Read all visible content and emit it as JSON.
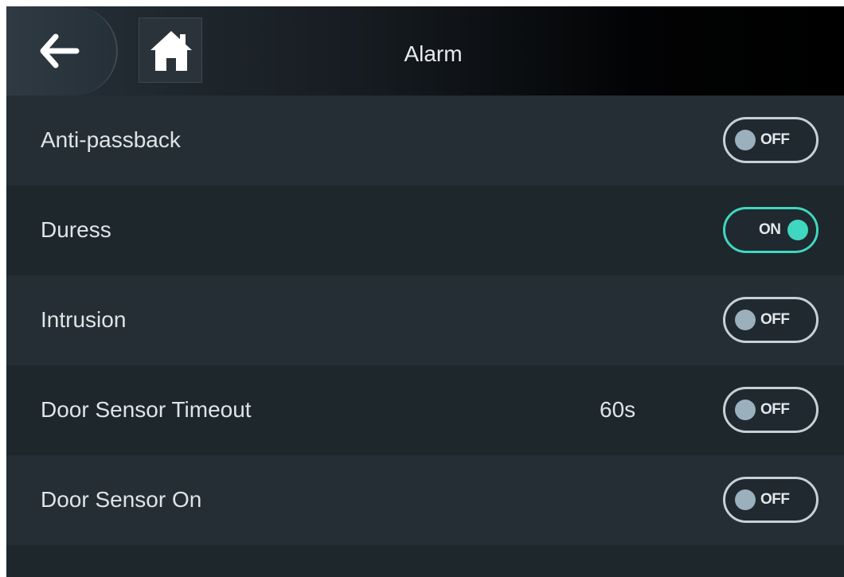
{
  "header": {
    "title": "Alarm",
    "back_icon": "arrow-left-icon",
    "home_icon": "home-icon"
  },
  "colors": {
    "toggle_on": "#3fd7bf",
    "toggle_off_knob": "#9bb0bd"
  },
  "settings": [
    {
      "label": "Anti-passback",
      "value": "",
      "toggle": "OFF",
      "on": false
    },
    {
      "label": "Duress",
      "value": "",
      "toggle": "ON",
      "on": true
    },
    {
      "label": "Intrusion",
      "value": "",
      "toggle": "OFF",
      "on": false
    },
    {
      "label": "Door Sensor Timeout",
      "value": "60s",
      "toggle": "OFF",
      "on": false
    },
    {
      "label": "Door Sensor On",
      "value": "",
      "toggle": "OFF",
      "on": false
    }
  ]
}
